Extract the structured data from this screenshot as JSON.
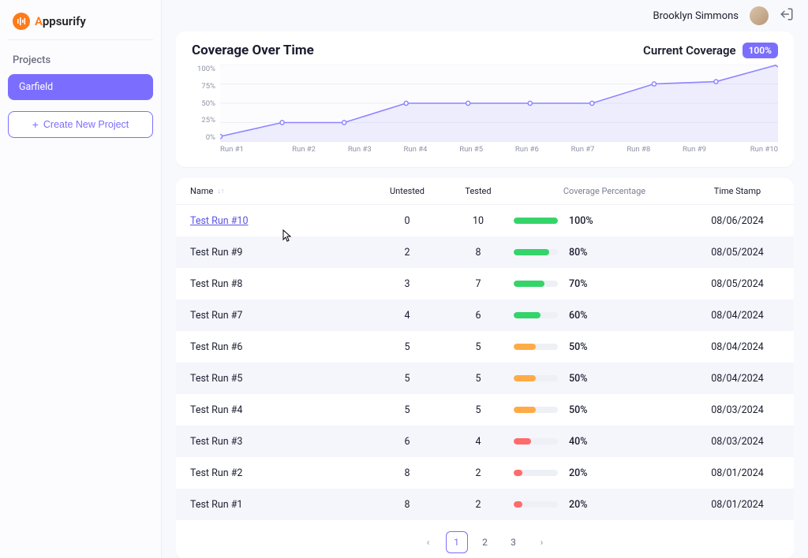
{
  "brand": {
    "name": "Appsurify"
  },
  "sidebar": {
    "section_label": "Projects",
    "projects": [
      {
        "name": "Garfield"
      }
    ],
    "create_label": "Create New Project"
  },
  "topbar": {
    "username": "Brooklyn Simmons"
  },
  "chart": {
    "title": "Coverage Over Time",
    "current_label": "Current Coverage",
    "current_value": "100%"
  },
  "chart_data": {
    "type": "line",
    "title": "Coverage Over Time",
    "xlabel": "",
    "ylabel": "",
    "ylim": [
      0,
      100
    ],
    "y_ticks": [
      "100%",
      "75%",
      "50%",
      "25%",
      "0%"
    ],
    "categories": [
      "Run #1",
      "Run #2",
      "Run #3",
      "Run #4",
      "Run #5",
      "Run #6",
      "Run #7",
      "Run #8",
      "Run #9",
      "Run #10"
    ],
    "values": [
      7,
      25,
      25,
      50,
      50,
      50,
      50,
      75,
      78,
      100
    ]
  },
  "table": {
    "headers": {
      "name": "Name",
      "untested": "Untested",
      "tested": "Tested",
      "coverage": "Coverage Percentage",
      "timestamp": "Time Stamp"
    },
    "rows": [
      {
        "name": "Test Run #10",
        "untested": "0",
        "tested": "10",
        "coverage_pct": 100,
        "coverage_label": "100%",
        "color": "green",
        "timestamp": "08/06/2024",
        "active": true
      },
      {
        "name": "Test Run #9",
        "untested": "2",
        "tested": "8",
        "coverage_pct": 80,
        "coverage_label": "80%",
        "color": "green",
        "timestamp": "08/05/2024"
      },
      {
        "name": "Test Run #8",
        "untested": "3",
        "tested": "7",
        "coverage_pct": 70,
        "coverage_label": "70%",
        "color": "green",
        "timestamp": "08/05/2024"
      },
      {
        "name": "Test Run #7",
        "untested": "4",
        "tested": "6",
        "coverage_pct": 60,
        "coverage_label": "60%",
        "color": "green",
        "timestamp": "08/04/2024"
      },
      {
        "name": "Test Run #6",
        "untested": "5",
        "tested": "5",
        "coverage_pct": 50,
        "coverage_label": "50%",
        "color": "orange",
        "timestamp": "08/04/2024"
      },
      {
        "name": "Test Run #5",
        "untested": "5",
        "tested": "5",
        "coverage_pct": 50,
        "coverage_label": "50%",
        "color": "orange",
        "timestamp": "08/04/2024"
      },
      {
        "name": "Test Run #4",
        "untested": "5",
        "tested": "5",
        "coverage_pct": 50,
        "coverage_label": "50%",
        "color": "orange",
        "timestamp": "08/03/2024"
      },
      {
        "name": "Test Run #3",
        "untested": "6",
        "tested": "4",
        "coverage_pct": 40,
        "coverage_label": "40%",
        "color": "red",
        "timestamp": "08/03/2024"
      },
      {
        "name": "Test Run #2",
        "untested": "8",
        "tested": "2",
        "coverage_pct": 20,
        "coverage_label": "20%",
        "color": "red",
        "timestamp": "08/01/2024"
      },
      {
        "name": "Test Run #1",
        "untested": "8",
        "tested": "2",
        "coverage_pct": 20,
        "coverage_label": "20%",
        "color": "red",
        "timestamp": "08/01/2024"
      }
    ]
  },
  "pagination": {
    "pages": [
      "1",
      "2",
      "3"
    ],
    "active": "1"
  }
}
